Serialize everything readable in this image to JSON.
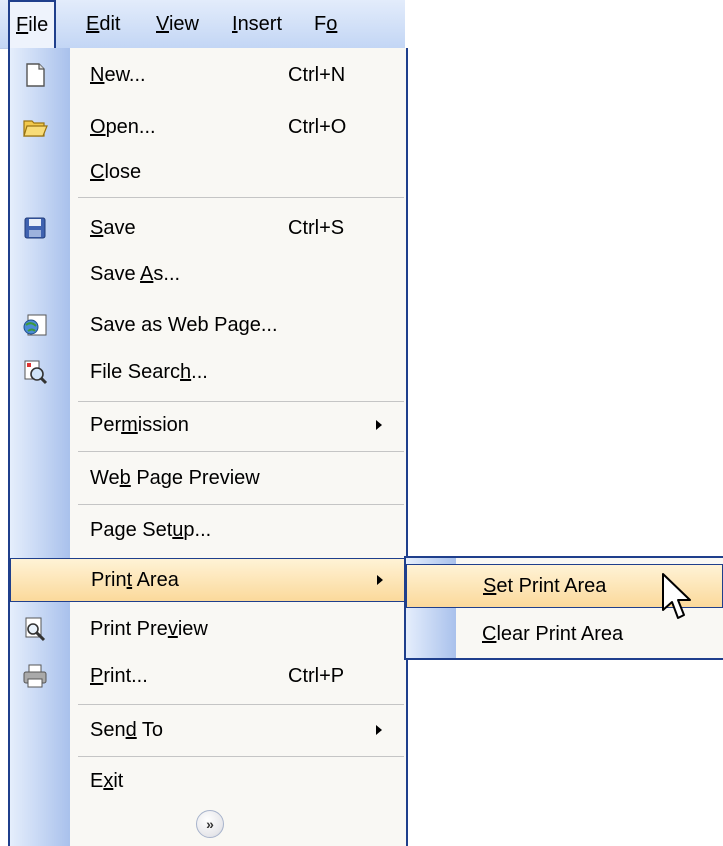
{
  "menubar": {
    "items": [
      {
        "label": "File",
        "active": true
      },
      {
        "label": "Edit"
      },
      {
        "label": "View"
      },
      {
        "label": "Insert"
      },
      {
        "label": "Fo"
      }
    ]
  },
  "file_menu": {
    "items": [
      {
        "label": "New...",
        "mnemonic": "N",
        "shortcut": "Ctrl+N",
        "icon": "new-document-icon"
      },
      {
        "label": "Open...",
        "mnemonic": "O",
        "shortcut": "Ctrl+O",
        "icon": "open-folder-icon"
      },
      {
        "label": "Close",
        "mnemonic": "C"
      },
      {
        "label": "Save",
        "mnemonic": "S",
        "shortcut": "Ctrl+S",
        "icon": "save-disk-icon"
      },
      {
        "label": "Save As...",
        "mnemonic": "A"
      },
      {
        "label": "Save as Web Page...",
        "mnemonic": "g",
        "icon": "web-page-icon"
      },
      {
        "label": "File Search...",
        "mnemonic": "h",
        "icon": "file-search-icon"
      },
      {
        "label": "Permission",
        "mnemonic": "m",
        "submenu": true
      },
      {
        "label": "Web Page Preview",
        "mnemonic": "b"
      },
      {
        "label": "Page Setup...",
        "mnemonic": "u"
      },
      {
        "label": "Print Area",
        "mnemonic": "t",
        "submenu": true,
        "highlighted": true
      },
      {
        "label": "Print Preview",
        "mnemonic": "v",
        "icon": "print-preview-icon"
      },
      {
        "label": "Print...",
        "mnemonic": "P",
        "shortcut": "Ctrl+P",
        "icon": "printer-icon"
      },
      {
        "label": "Send To",
        "mnemonic": "d",
        "submenu": true
      },
      {
        "label": "Exit",
        "mnemonic": "x"
      }
    ],
    "expand_icon": "double-chevron-down-icon"
  },
  "print_area_submenu": {
    "items": [
      {
        "label": "Set Print Area",
        "mnemonic": "S",
        "highlighted": true
      },
      {
        "label": "Clear Print Area",
        "mnemonic": "C"
      }
    ]
  },
  "cursor": "arrow-cursor-icon",
  "colors": {
    "menu_border": "#1f3f8c",
    "highlight_top": "#fff3d6",
    "highlight_bottom": "#fbd99b",
    "icon_strip_light": "#e5eefc",
    "icon_strip_dark": "#a9c1ec",
    "menu_background": "#f9f8f4"
  }
}
